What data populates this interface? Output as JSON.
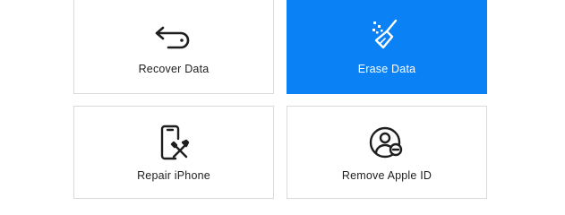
{
  "tiles": {
    "recover": {
      "label": "Recover Data",
      "icon": "recover-arrow-icon"
    },
    "erase": {
      "label": "Erase Data",
      "icon": "broom-icon",
      "accent": "#0a82f6"
    },
    "repair": {
      "label": "Repair iPhone",
      "icon": "phone-repair-icon"
    },
    "remove": {
      "label": "Remove Apple ID",
      "icon": "remove-user-icon"
    }
  }
}
